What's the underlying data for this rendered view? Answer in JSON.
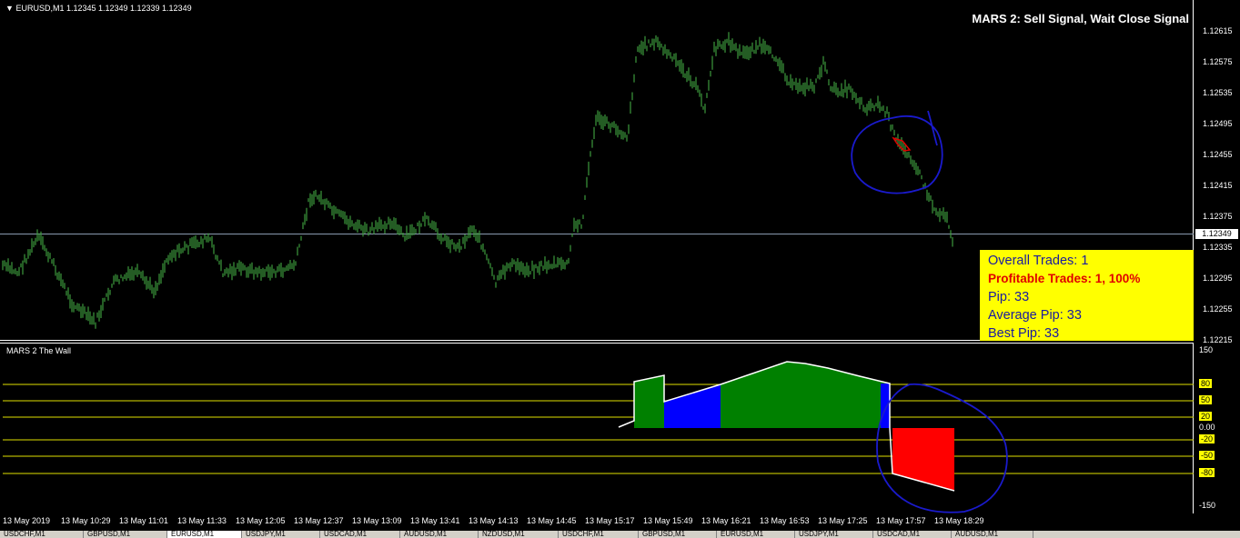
{
  "chart": {
    "symbol_info": "EURUSD,M1  1.12345 1.12349 1.12339 1.12349",
    "signal_text": "MARS 2: Sell Signal, Wait Close Signal",
    "price_ticks": [
      "1.12615",
      "1.12575",
      "1.12535",
      "1.12495",
      "1.12455",
      "1.12415",
      "1.12375",
      "1.12335",
      "1.12295",
      "1.12255",
      "1.12215"
    ],
    "current_price": "1.12349",
    "stats": {
      "overall": "Overall Trades: 1",
      "profitable": "Profitable Trades: 1, 100%",
      "pip": "Pip: 33",
      "average": "Average Pip: 33",
      "best": "Best Pip: 33"
    }
  },
  "indicator": {
    "title": "MARS 2 The Wall",
    "scale_top": "150",
    "scale_bottom": "-150",
    "zero": "0.00",
    "levels": [
      "80",
      "50",
      "20",
      "-20",
      "-50",
      "-80"
    ]
  },
  "time_axis": [
    "13 May 2019",
    "13 May 10:29",
    "13 May 11:01",
    "13 May 11:33",
    "13 May 12:05",
    "13 May 12:37",
    "13 May 13:09",
    "13 May 13:41",
    "13 May 14:13",
    "13 May 14:45",
    "13 May 15:17",
    "13 May 15:49",
    "13 May 16:21",
    "13 May 16:53",
    "13 May 17:25",
    "13 May 17:57",
    "13 May 18:29"
  ],
  "tabs": [
    "USDCHF,M1",
    "GBPUSD,M1",
    "EURUSD,M1",
    "USDJPY,M1",
    "USDCAD,M1",
    "AUDUSD,M1",
    "NZDUSD,M1",
    "USDCHF,M1",
    "GBPUSD,M1",
    "EURUSD,M1",
    "USDJPY,M1",
    "USDCAD,M1",
    "AUDUSD,M1"
  ],
  "colors": {
    "candle": "#3d9a3d",
    "green_zone": "#008000",
    "blue_zone": "#0000ff",
    "red_zone": "#ff0000",
    "stats_bg": "#ffff00",
    "annotation": "#1a1acc"
  }
}
